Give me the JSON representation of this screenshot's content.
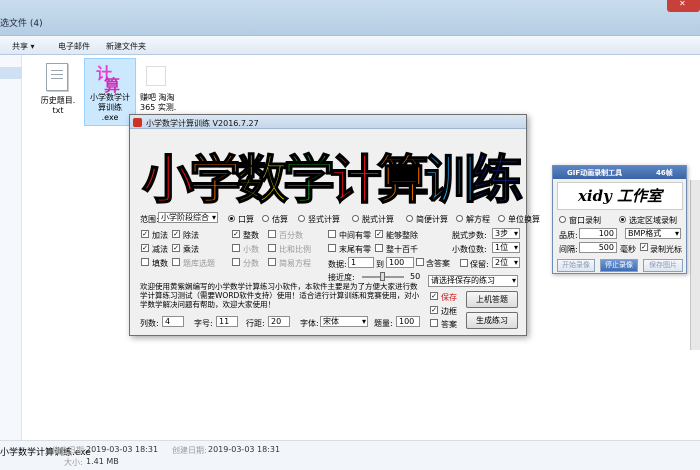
{
  "explorer": {
    "folder_title": "选文件 (4)",
    "toolbar": {
      "share": "共享 ▾",
      "email": "电子邮件",
      "new_folder": "新建文件夹"
    },
    "files": [
      {
        "name_line1": "历史题目.",
        "name_line2": "txt"
      },
      {
        "name_line1": "小学数学计",
        "name_line2": "算训练",
        "name_line3": ".exe"
      },
      {
        "name_line1": "赚吧 淘淘",
        "name_line2": "365 实测."
      }
    ],
    "exe_icon_chars": [
      "计",
      "算"
    ],
    "status": {
      "filename": "小学数学计算训练.exe",
      "modified_label": "修改日期:",
      "modified": "2019-03-03 18:31",
      "created_label": "创建日期:",
      "created": "2019-03-03 18:31",
      "size_label": "大小:",
      "size": "1.41 MB"
    }
  },
  "app": {
    "title": "小学数学计算训练 V2016.7.27",
    "banner_chars": [
      {
        "ch": "小",
        "color": "#e8131a"
      },
      {
        "ch": "学",
        "color": "#ff7a00"
      },
      {
        "ch": "数",
        "color": "#f0e000"
      },
      {
        "ch": "学",
        "color": "#25b52d"
      },
      {
        "ch": "计",
        "color": "#e8131a"
      },
      {
        "ch": "算",
        "color": "#ff7a00"
      },
      {
        "ch": "训",
        "color": "#1ea8f0"
      },
      {
        "ch": "练",
        "color": "#1a2ac8"
      }
    ],
    "range_label": "范围:",
    "range_value": "小学阶段综合",
    "modes": [
      "口算",
      "估算",
      "竖式计算",
      "脱式计算",
      "简便计算",
      "解方程",
      "单位换算"
    ],
    "ops": {
      "add": "加法",
      "sub": "减法",
      "mul": "乘法",
      "div": "除法",
      "fill": "填数",
      "blank": "题库选题"
    },
    "types": {
      "integer": "整数",
      "decimal": "小数",
      "fraction": "分数",
      "percent": "百分数",
      "ratio": "比和比例",
      "simple": "简易方程"
    },
    "options": {
      "middle_zero": "中间有零",
      "end_zero": "末尾有零",
      "remainder": "能够整除",
      "whole_ten": "整十百千"
    },
    "range_num_label": "数据:",
    "range_from": "1",
    "range_to_label": "到",
    "range_to": "100",
    "all_answer": "含答案",
    "closeness_label": "接近度:",
    "closeness_value": "50",
    "steps_label": "脱式步数:",
    "steps_value": "3步",
    "decimals_label": "小数位数:",
    "decimals_value": "1位",
    "keep_label": "保留:",
    "keep_value": "2位",
    "save_practice_placeholder": "请选择保存的练习",
    "save_label": "保存",
    "border_label": "边框",
    "answer_label": "答案",
    "machine_btn": "上机答题",
    "generate_btn": "生成练习",
    "intro": "欢迎使用黄紫娴编写的小学数学计算练习小软件，本软件主要是为了方便大家进行数学计算练习测试（需要WORD软件支持）使用！适合进行计算训练和竞赛使用，对小学数学解决问题有帮助，欢迎大家使用！",
    "bottom": {
      "columns_label": "列数:",
      "columns": "4",
      "fontsize_label": "字号:",
      "fontsize": "11",
      "rowgap_label": "行距:",
      "rowgap": "20",
      "font_label": "字体:",
      "font": "宋体",
      "count_label": "题量:",
      "count": "100"
    }
  },
  "gif": {
    "title": "GIF动画录制工具",
    "fps": "46帧",
    "logo": "xidy 工作室",
    "window_rec": "窗口录制",
    "region_rec": "选定区域录制",
    "quality_label": "品质:",
    "quality": "100",
    "format": "BMP格式",
    "interval_label": "间隔:",
    "interval": "500",
    "ms_label": "毫秒",
    "cursor_label": "录制光标",
    "start": "开始录像",
    "stop": "停止录像",
    "save": "保存图片"
  }
}
